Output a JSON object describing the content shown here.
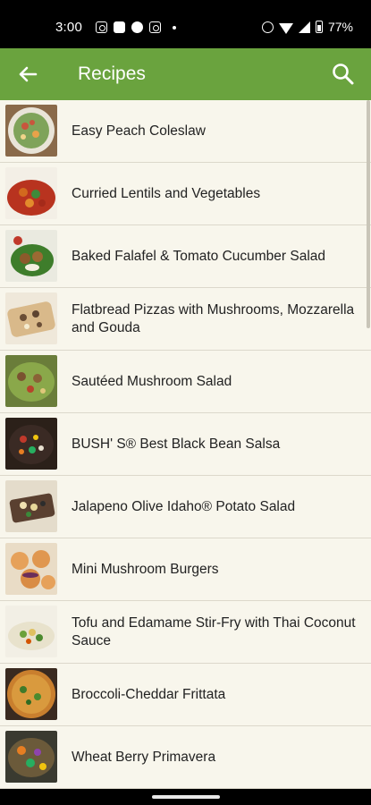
{
  "status_bar": {
    "time": "3:00",
    "battery": "77%",
    "left_icons": [
      "instagram-icon",
      "flipboard-icon",
      "facebook-icon",
      "instagram-icon",
      "dot-icon"
    ],
    "right_icons": [
      "alarm-icon",
      "wifi-icon",
      "signal-icon",
      "battery-icon"
    ]
  },
  "app_bar": {
    "title": "Recipes",
    "back_icon": "arrow-left-icon",
    "search_icon": "search-icon",
    "color": "#6aa33e"
  },
  "recipes": [
    {
      "label": "Easy Peach Coleslaw",
      "thumb": "coleslaw"
    },
    {
      "label": "Curried Lentils and Vegetables",
      "thumb": "curry"
    },
    {
      "label": "Baked Falafel & Tomato Cucumber Salad",
      "thumb": "falafel"
    },
    {
      "label": "Flatbread Pizzas with Mushrooms, Mozzarella and Gouda",
      "thumb": "flatbread"
    },
    {
      "label": "Sautéed Mushroom Salad",
      "thumb": "salad"
    },
    {
      "label": "BUSH' S® Best Black Bean Salsa",
      "thumb": "salsa"
    },
    {
      "label": "Jalapeno Olive Idaho® Potato Salad",
      "thumb": "potato"
    },
    {
      "label": "Mini Mushroom Burgers",
      "thumb": "burgers"
    },
    {
      "label": "Tofu and Edamame Stir-Fry with Thai Coconut Sauce",
      "thumb": "stirfry"
    },
    {
      "label": "Broccoli-Cheddar Frittata",
      "thumb": "frittata"
    },
    {
      "label": "Wheat Berry Primavera",
      "thumb": "primavera"
    }
  ]
}
